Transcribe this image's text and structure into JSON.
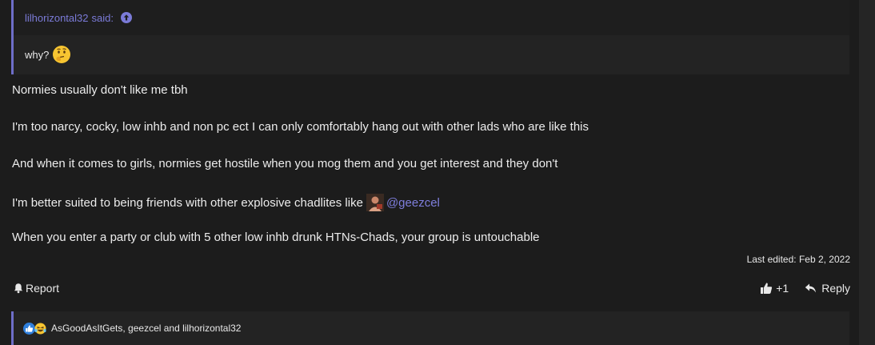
{
  "quote": {
    "author": "lilhorizontal32",
    "said_label": "said:",
    "text": "why?"
  },
  "post": {
    "lines": [
      "Normies usually don't like me tbh",
      "I'm too narcy, cocky, low inhb and non pc ect I can only comfortably hang out with other lads who are like this",
      "And when it comes to girls, normies get hostile when you mog them and you get interest and they don't",
      "I'm better suited to being friends with other explosive chadlites like",
      "When you enter a party or club with 5 other low inhb drunk HTNs-Chads, your group is untouchable"
    ],
    "mention": "@geezcel",
    "last_edited": "Last edited: Feb 2, 2022"
  },
  "actions": {
    "report_label": "Report",
    "like_count": "+1",
    "reply_label": "Reply"
  },
  "reactions": {
    "users_text": "AsGoodAsItGets, geezcel and lilhorizontal32"
  },
  "colors": {
    "background": "#1c1c1c",
    "quote_border": "#6e6ec8",
    "link": "#7e7edc"
  }
}
